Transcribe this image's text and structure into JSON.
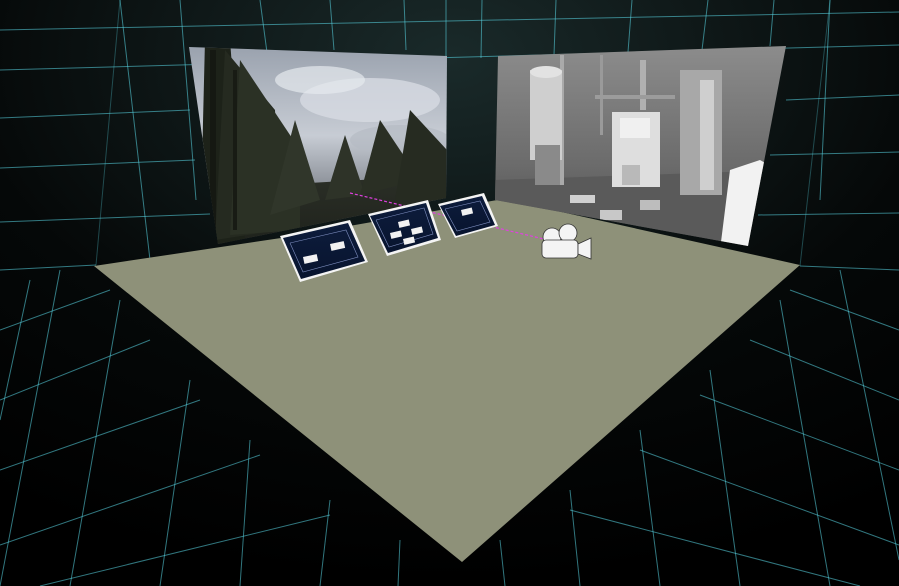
{
  "scene": {
    "background_color": "#070d0f",
    "grid_color": "#5ad7e6",
    "floor_color": "#8e9179",
    "laser_color": "#e040e0"
  },
  "panels": [
    {
      "name": "panel-left",
      "title": "",
      "buttons": [
        {
          "label": ""
        },
        {
          "label": ""
        }
      ]
    },
    {
      "name": "panel-center",
      "title": "",
      "buttons": [
        {
          "label": ""
        },
        {
          "label": ""
        },
        {
          "label": ""
        },
        {
          "label": ""
        }
      ]
    },
    {
      "name": "panel-right",
      "title": "",
      "buttons": [
        {
          "label": ""
        }
      ]
    }
  ],
  "screens": [
    {
      "name": "forest-video-screen",
      "subject": "forest-sky"
    },
    {
      "name": "boiler-room-video-screen",
      "subject": "boiler-room"
    }
  ],
  "icons": {
    "camera": "movie-camera-icon"
  }
}
